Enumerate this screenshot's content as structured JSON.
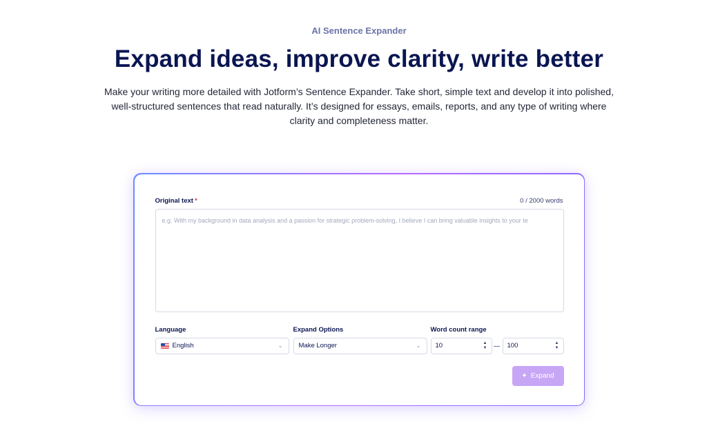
{
  "hero": {
    "eyebrow": "AI Sentence Expander",
    "title": "Expand ideas, improve clarity, write better",
    "description": "Make your writing more detailed with Jotform’s Sentence Expander. Take short, simple text and develop it into polished, well-structured sentences that read naturally. It’s designed for essays, emails, reports, and any type of writing where clarity and completeness matter."
  },
  "form": {
    "original_text_label": "Original text",
    "required_mark": "*",
    "word_counter": "0 / 2000 words",
    "textarea_placeholder": "e.g. With my background in data analysis and a passion for strategic problem-solving, I believe I can bring valuable insights to your te",
    "language_label": "Language",
    "language_value": "English",
    "language_flag": "us-flag-icon",
    "expand_options_label": "Expand Options",
    "expand_options_value": "Make Longer",
    "word_count_label": "Word count range",
    "word_count_min": "10",
    "word_count_max": "100",
    "expand_button": "Expand"
  },
  "colors": {
    "heading": "#0a1551",
    "accent_gradient_start": "#6b8cff",
    "accent_gradient_mid": "#b76bff",
    "button_disabled": "#c7a6f5"
  }
}
